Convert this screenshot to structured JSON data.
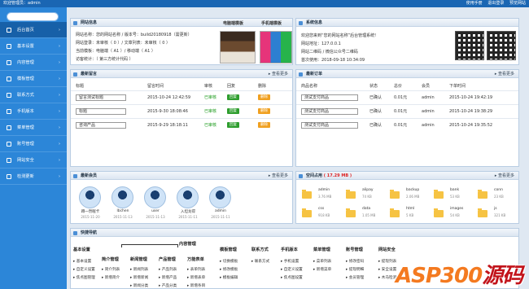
{
  "topbar": {
    "welcome": "欢迎管理员：admin",
    "links": [
      "使用手册",
      "退出登录",
      "预览网站"
    ]
  },
  "sidebar": {
    "items": [
      {
        "label": "后台首页",
        "active": true
      },
      {
        "label": "基本设置"
      },
      {
        "label": "内容管理"
      },
      {
        "label": "模板管理"
      },
      {
        "label": "联系方式"
      },
      {
        "label": "手机版本"
      },
      {
        "label": "菜单管理"
      },
      {
        "label": "账号管理"
      },
      {
        "label": "网站安全"
      },
      {
        "label": "检测更新"
      }
    ]
  },
  "site_info": {
    "title": "网站信息",
    "tabs": [
      "电脑端模板",
      "手机端模板"
    ],
    "lines": [
      "网站名称：您的网站名称 / 版本号：build20180918（需更新）",
      "网站登录：未审核（ 0 ）/ 文章列表：未审核（ 0 ）",
      "当前模板：电脑端（ A1 ）/ 移动端（ A1 ）",
      "访客统计：（ 第三方统计代码 ）"
    ]
  },
  "sys_info": {
    "title": "系统信息",
    "lines": [
      "欢迎您来到“您的网站名称”后台管理系统!",
      "网站地址：127.0.0.1",
      "网站二维码 / 微信公众号二维码",
      "首次使用：2018-09-18 10:34:09"
    ]
  },
  "messages": {
    "title": "最新留言",
    "more": "查看更多",
    "headers": [
      "标题",
      "留言时间",
      "审核",
      "回复",
      "删除"
    ],
    "rows": [
      {
        "title": "留言测试标题",
        "time": "2015-10-24 12:42:59",
        "status": "已审核",
        "reply": "回复",
        "del": "删除"
      },
      {
        "title": "标题",
        "time": "2015-9-30 18:08:46",
        "status": "已审核",
        "reply": "回复",
        "del": "删除"
      },
      {
        "title": "咨询产品",
        "time": "2015-9-29 18:18:11",
        "status": "已审核",
        "reply": "回复",
        "del": "删除"
      }
    ]
  },
  "orders": {
    "title": "最新订单",
    "more": "查看更多",
    "headers": [
      "商品名称",
      "状态",
      "总价",
      "会员",
      "下单时间"
    ],
    "rows": [
      {
        "name": "测试支付商品",
        "status": "已确认",
        "price": "0.01元",
        "member": "admin",
        "time": "2015-10-24 19:42:19"
      },
      {
        "name": "测试支付商品",
        "status": "已确认",
        "price": "0.01元",
        "member": "admin",
        "time": "2015-10-24 19:38:29"
      },
      {
        "name": "测试支付商品",
        "status": "已确认",
        "price": "0.01元",
        "member": "admin",
        "time": "2015-10-24 19:35:52"
      }
    ]
  },
  "members": {
    "title": "最新会员",
    "more": "查看更多",
    "list": [
      {
        "name": "蹲一然眠卡",
        "date": "2015-11-20"
      },
      {
        "name": "lbchen",
        "date": "2015-11-13"
      },
      {
        "name": "user",
        "date": "2015-11-13"
      },
      {
        "name": "入坦龙得",
        "date": "2015-11-11"
      },
      {
        "name": "admin",
        "date": "2015-11-11"
      }
    ]
  },
  "space": {
    "title": "空间占用",
    "size": "17.29 MB",
    "more": "查看更多",
    "folders": [
      {
        "name": "admin",
        "size": "3.76 MB"
      },
      {
        "name": "alipay",
        "size": "74 KB"
      },
      {
        "name": "backup",
        "size": "2.06 MB"
      },
      {
        "name": "bank",
        "size": "53 KB"
      },
      {
        "name": "conn",
        "size": "23 KB"
      },
      {
        "name": "css",
        "size": "918 KB"
      },
      {
        "name": "data",
        "size": "1.05 MB"
      },
      {
        "name": "html",
        "size": "5 KB"
      },
      {
        "name": "images",
        "size": "54 KB"
      },
      {
        "name": "js",
        "size": "321 KB"
      }
    ]
  },
  "quicknav": {
    "title": "快捷导航",
    "overlay": "内容管理",
    "sections": [
      {
        "name": "基本设置",
        "items": [
          "基本设置",
          "自定义设置",
          "焦点图管理"
        ]
      },
      {
        "name": "简介管理",
        "items": [
          "简介列表",
          "新增简介"
        ]
      },
      {
        "name": "新闻管理",
        "items": [
          "新闻列表",
          "新增新闻",
          "新闻分类"
        ]
      },
      {
        "name": "产品管理",
        "items": [
          "产品列表",
          "新增产品",
          "产品分类"
        ]
      },
      {
        "name": "万能表单",
        "items": [
          "表单列表",
          "新增表单",
          "新增条目"
        ]
      },
      {
        "name": "模板管理",
        "items": [
          "切换模板",
          "修改模板",
          "模板编辑"
        ]
      },
      {
        "name": "联系方式",
        "items": [
          "联系方式"
        ]
      },
      {
        "name": "手机版本",
        "items": [
          "手机设置",
          "自定义设置",
          "焦点图设置"
        ]
      },
      {
        "name": "菜单管理",
        "items": [
          "菜单列表",
          "新增菜单"
        ]
      },
      {
        "name": "账号管理",
        "items": [
          "修改密码",
          "提现明细",
          "会员管理"
        ]
      },
      {
        "name": "网站安全",
        "items": [
          "提现列表",
          "安全设置",
          "木马检测"
        ]
      }
    ]
  },
  "watermark": {
    "main": "ASP300",
    "cn": "源码"
  },
  "colors": {
    "sidebar": "#2c86d8",
    "topbar": "#1a66b3",
    "accent": "#4b8fd6"
  }
}
